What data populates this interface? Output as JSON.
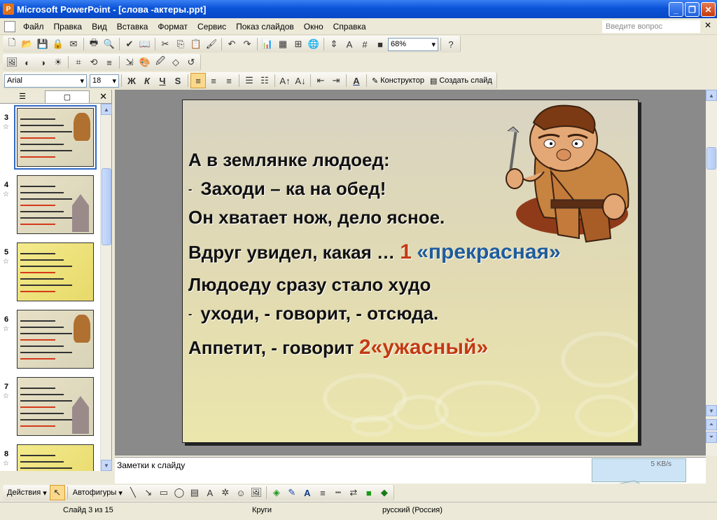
{
  "window": {
    "title": "Microsoft PowerPoint - [слова -актеры.ppt]"
  },
  "menu": {
    "items": [
      "Файл",
      "Правка",
      "Вид",
      "Вставка",
      "Формат",
      "Сервис",
      "Показ слайдов",
      "Окно",
      "Справка"
    ],
    "help_placeholder": "Введите вопрос"
  },
  "toolbar": {
    "zoom": "68%",
    "font": "Arial",
    "size": "18",
    "bold": "Ж",
    "italic": "К",
    "underline": "Ч",
    "shadow": "S",
    "designer": "Конструктор",
    "new_slide": "Создать слайд"
  },
  "thumbnails": [
    {
      "num": "3",
      "kind": "ogre",
      "selected": true
    },
    {
      "num": "4",
      "kind": "castle",
      "selected": false
    },
    {
      "num": "5",
      "kind": "bright",
      "selected": false
    },
    {
      "num": "6",
      "kind": "ogre",
      "selected": false
    },
    {
      "num": "7",
      "kind": "castle",
      "selected": false
    },
    {
      "num": "8",
      "kind": "table",
      "selected": false
    }
  ],
  "slide": {
    "line1": "А в землянке людоед:",
    "line2_dash": "-",
    "line2": "Заходи – ка на обед!",
    "line3": "Он хватает нож, дело ясное.",
    "line4_prefix": "Вдруг увидел, какая …",
    "line4_num": "1",
    "line4_word": "«прекрасная»",
    "line5": "Людоеду сразу стало худо",
    "line6_dash": "-",
    "line6": "уходи, - говорит, - отсюда.",
    "line7_prefix": "Аппетит, - говорит",
    "line7_num": "2",
    "line7_word": "«ужасный»"
  },
  "notes": {
    "placeholder": "Заметки к слайду"
  },
  "network": {
    "speed": "5 KB/s"
  },
  "draw": {
    "actions": "Действия",
    "autoshapes": "Автофигуры"
  },
  "status": {
    "slide": "Слайд 3 из 15",
    "design": "Круги",
    "lang": "русский (Россия)"
  },
  "colors": {
    "accent_red": "#c43a12",
    "accent_blue": "#1f5c9b",
    "title_bar": "#0a53d8"
  }
}
